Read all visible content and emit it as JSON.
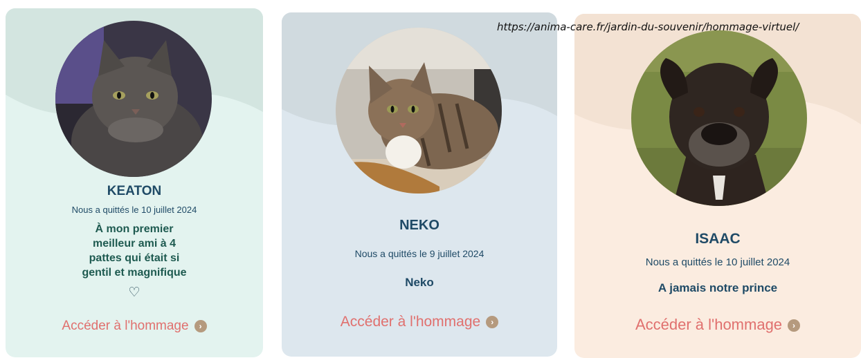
{
  "source_url": "https://anima-care.fr/jardin-du-souvenir/hommage-virtuel/",
  "link_label": "Accéder à l'hommage",
  "cards": [
    {
      "name": "KEATON",
      "date": "Nous a quittés le 10 juillet 2024",
      "message_lines": [
        "À mon premier",
        "meilleur ami à 4",
        "pattes qui était si",
        "gentil et magnifique"
      ],
      "heart": "♡",
      "photo": "long-haired-gray-cat",
      "bg_color": "#e3f3ef",
      "top_color": "#d3e5e0"
    },
    {
      "name": "NEKO",
      "date": "Nous a quittés le 9 juillet 2024",
      "message": "Neko",
      "photo": "tabby-cat",
      "bg_color": "#dde7ee",
      "top_color": "#d0dadf"
    },
    {
      "name": "ISAAC",
      "date": "Nous a quittés le 10 juillet 2024",
      "message": "A jamais notre prince",
      "photo": "brindle-boxer-dog",
      "bg_color": "#fbece0",
      "top_color": "#f3e2d3"
    }
  ]
}
